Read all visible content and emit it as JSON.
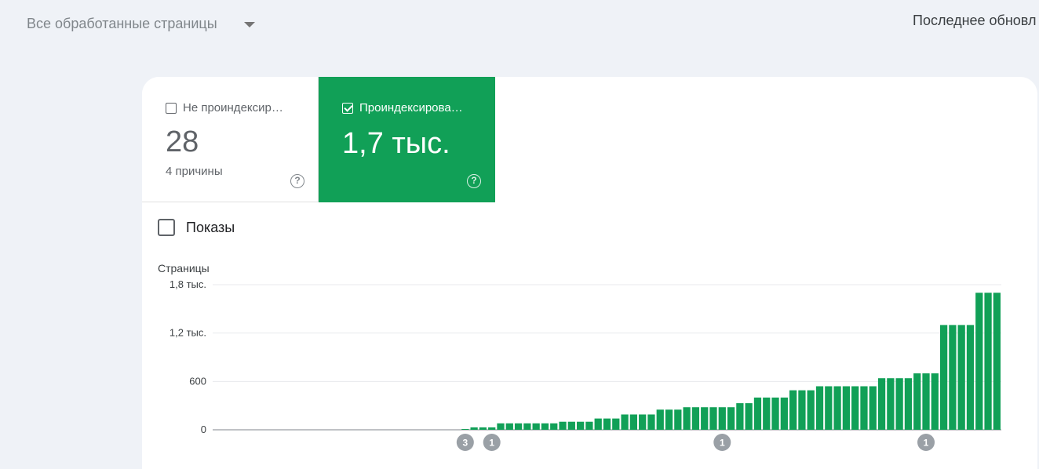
{
  "filter": {
    "label": "Все обработанные страницы",
    "icon": "caret-down-icon"
  },
  "header": {
    "last_update": "Последнее обновл"
  },
  "tiles": [
    {
      "title": "Не проиндексир…",
      "value": "28",
      "subtitle": "4 причины",
      "checked": false,
      "help": "?"
    },
    {
      "title": "Проиндексирова…",
      "value": "1,7 тыс.",
      "checked": true,
      "help": "?",
      "color": "#11a057"
    }
  ],
  "impressions": {
    "label": "Показы",
    "checked": false
  },
  "chart_data": {
    "type": "bar",
    "ylabel": "Страницы",
    "ylim": [
      0,
      1800
    ],
    "yticks": [
      {
        "value": 1800,
        "label": "1,8 тыс."
      },
      {
        "value": 1200,
        "label": "1,2 тыс."
      },
      {
        "value": 600,
        "label": "600"
      },
      {
        "value": 0,
        "label": "0"
      }
    ],
    "bar_color": "#11a057",
    "values": [
      0,
      0,
      0,
      0,
      0,
      0,
      0,
      0,
      0,
      0,
      0,
      0,
      0,
      0,
      0,
      0,
      0,
      0,
      0,
      0,
      0,
      0,
      0,
      0,
      0,
      0,
      0,
      0,
      10,
      30,
      30,
      30,
      80,
      80,
      80,
      80,
      80,
      80,
      80,
      100,
      100,
      100,
      100,
      140,
      140,
      140,
      190,
      190,
      190,
      190,
      250,
      250,
      250,
      280,
      280,
      280,
      280,
      280,
      280,
      330,
      330,
      400,
      400,
      400,
      400,
      490,
      490,
      490,
      540,
      540,
      540,
      540,
      540,
      540,
      540,
      640,
      640,
      640,
      640,
      700,
      700,
      700,
      1300,
      1300,
      1300,
      1300,
      1700,
      1700,
      1700
    ],
    "annotations": [
      {
        "index": 28,
        "label": "3"
      },
      {
        "index": 31,
        "label": "1"
      },
      {
        "index": 57,
        "label": "1"
      },
      {
        "index": 80,
        "label": "1"
      }
    ]
  }
}
